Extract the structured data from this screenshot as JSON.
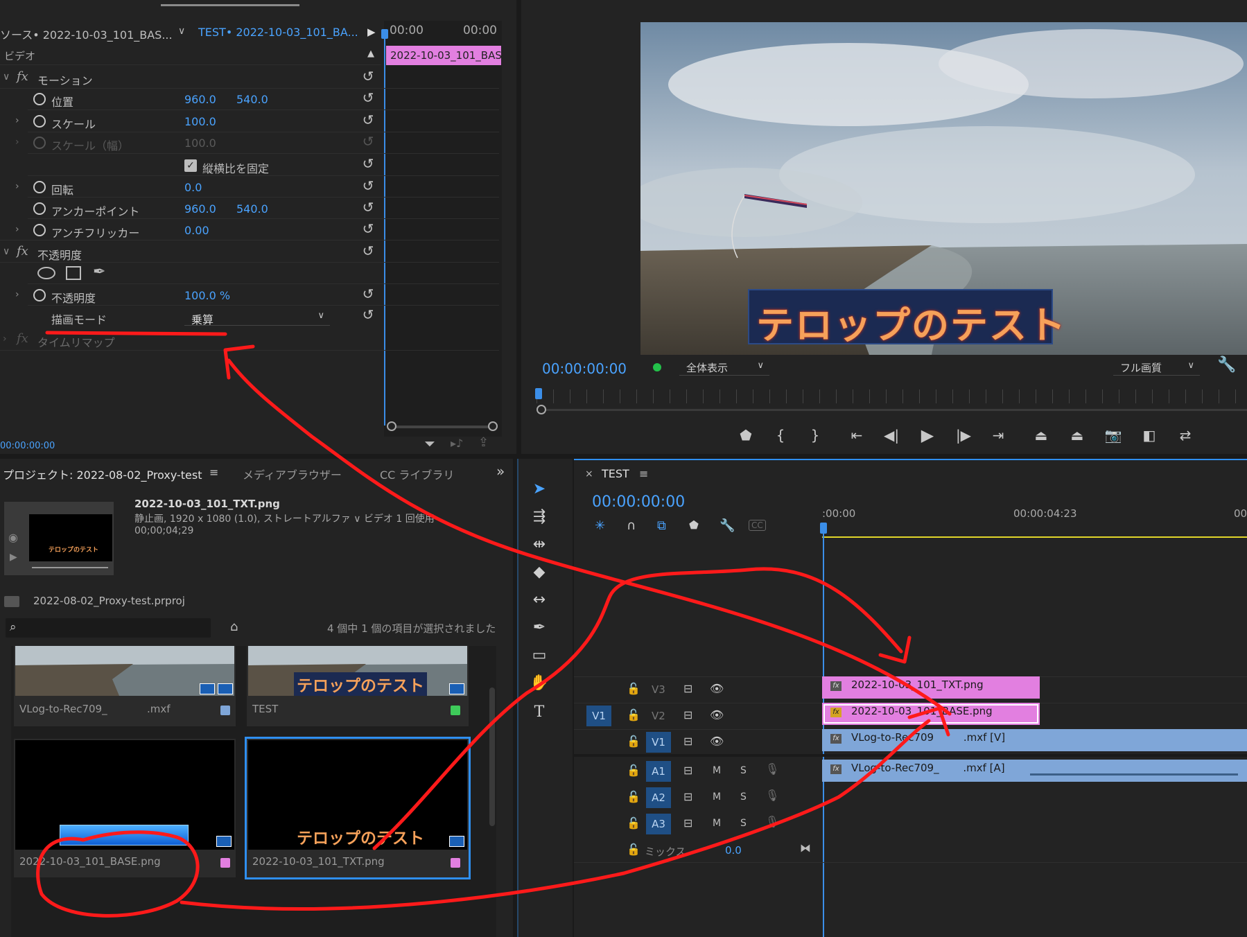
{
  "effect_controls": {
    "source_tab": "ソース• 2022-10-03_101_BAS...",
    "sequence_tab": "TEST• 2022-10-03_101_BA...",
    "mini_timecode_a": "00:00",
    "mini_timecode_b": "00:00",
    "mini_clip": "2022-10-03_101_BAS",
    "section_video": "ビデオ",
    "motion": "モーション",
    "position_label": "位置",
    "position_x": "960.0",
    "position_y": "540.0",
    "scale_label": "スケール",
    "scale_val": "100.0",
    "scale_width_label": "スケール（幅）",
    "scale_width_val": "100.0",
    "uniform_scale": "縦横比を固定",
    "rotation_label": "回転",
    "rotation_val": "0.0",
    "anchor_label": "アンカーポイント",
    "anchor_x": "960.0",
    "anchor_y": "540.0",
    "antiflicker_label": "アンチフリッカー",
    "antiflicker_val": "0.00",
    "opacity_section": "不透明度",
    "opacity_label": "不透明度",
    "opacity_val": "100.0 %",
    "blend_label": "描画モード",
    "blend_val": "乗算",
    "timeremap": "タイムリマップ",
    "bottom_timecode": "00:00:00:00"
  },
  "program": {
    "overlay_text": "テロップのテスト",
    "timecode": "00:00:00:00",
    "fit": "全体表示",
    "quality": "フル画質"
  },
  "project": {
    "title": "プロジェクト: 2022-08-02_Proxy-test",
    "tab_media": "メディアブラウザー",
    "tab_cc": "CC ライブラリ",
    "selected_name": "2022-10-03_101_TXT.png",
    "selected_info": "静止画, 1920 x 1080 (1.0), ストレートアルファ ∨ ビデオ 1 回使用",
    "selected_duration": "00;00;04;29",
    "thumb_text": "テロップのテスト",
    "prproj": "2022-08-02_Proxy-test.prproj",
    "count": "4 個中 1 個の項目が選択されました",
    "items": [
      {
        "name": "VLog-to-Rec709_",
        "ext": ".mxf",
        "color": "#7fa6d8"
      },
      {
        "name": "TEST",
        "color": "#3ecb5a"
      },
      {
        "name": "2022-10-03_101_BASE.png",
        "color": "#e27fe0"
      },
      {
        "name": "2022-10-03_101_TXT.png",
        "color": "#e27fe0"
      }
    ]
  },
  "timeline": {
    "seq_name": "TEST",
    "timecode": "00:00:00:00",
    "ruler_start": ":00:00",
    "ruler_mid": "00:00:04:23",
    "ruler_end": "00",
    "tracks": {
      "v3": "V3",
      "v2": "V2",
      "v1": "V1",
      "src_v1": "V1",
      "a1": "A1",
      "a2": "A2",
      "a3": "A3",
      "mute": "M",
      "solo": "S",
      "mix": "ミックス",
      "mix_val": "0.0"
    },
    "clips": {
      "txt": "2022-10-03_101_TXT.png",
      "base": "2022-10-03_101_BASE.png",
      "video": "VLog-to-Rec709",
      "video_suffix": ".mxf [V]",
      "audio": "VLog-to-Rec709_",
      "audio_suffix": ".mxf [A]"
    }
  },
  "colors": {
    "accent": "#4aa3ff",
    "clip_pink": "#e27fe0",
    "clip_blue": "#7fa6d8",
    "annotation_red": "#ff1a1a"
  }
}
